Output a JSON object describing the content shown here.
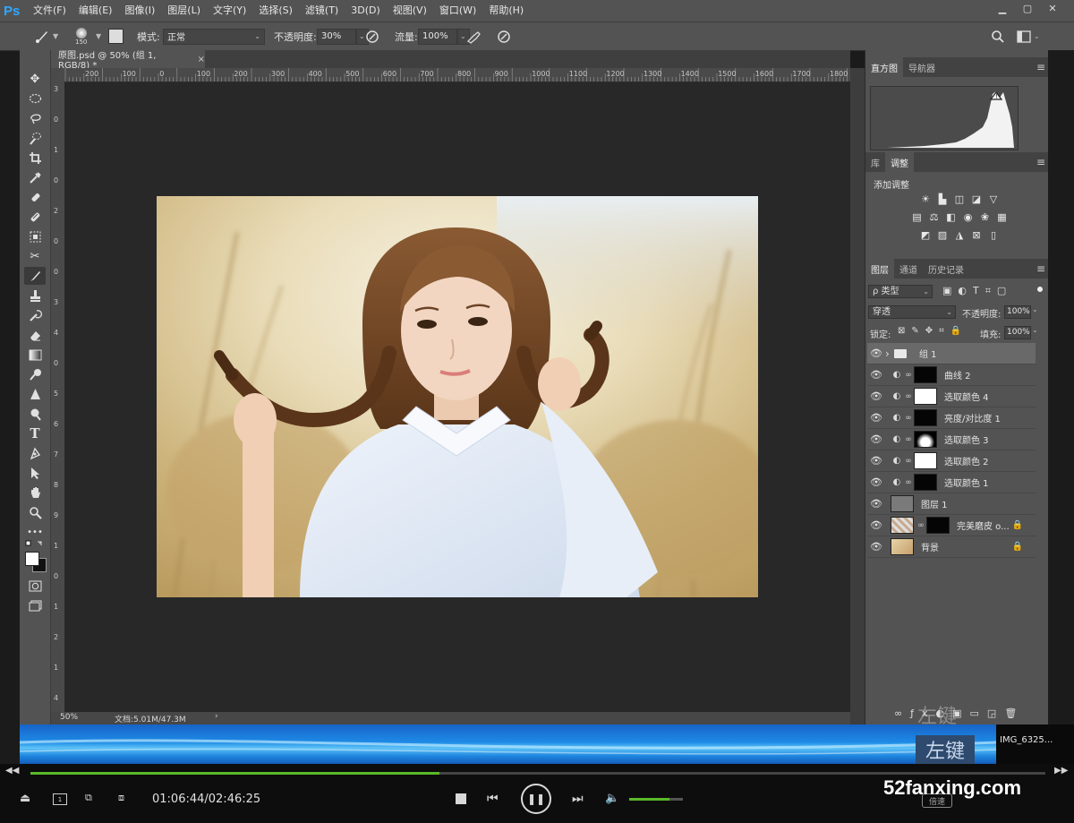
{
  "app": {
    "logo": "Ps"
  },
  "menu": [
    "文件(F)",
    "编辑(E)",
    "图像(I)",
    "图层(L)",
    "文字(Y)",
    "选择(S)",
    "滤镜(T)",
    "3D(D)",
    "视图(V)",
    "窗口(W)",
    "帮助(H)"
  ],
  "window_controls": [
    "minimize-icon",
    "restore-icon",
    "close-icon"
  ],
  "options": {
    "brush_size": "150",
    "mode_label": "模式:",
    "mode_value": "正常",
    "opacity_label": "不透明度:",
    "opacity_value": "30%",
    "flow_label": "流量:",
    "flow_value": "100%"
  },
  "document": {
    "tab_title": "原图.psd @ 50% (组 1, RGB/8) *",
    "close": "×",
    "zoom": "50%",
    "doc_info": "文档:5.01M/47.3M",
    "ruler_h": [
      "200",
      "100",
      "0",
      "100",
      "200",
      "300",
      "400",
      "500",
      "600",
      "700",
      "800",
      "900",
      "1000",
      "1100",
      "1200",
      "1300",
      "1400",
      "1500",
      "1600",
      "1700",
      "1800"
    ],
    "ruler_v": [
      "3",
      "0",
      "1",
      "0",
      "2",
      "0",
      "0",
      "3",
      "4",
      "0",
      "5",
      "6",
      "7",
      "8",
      "9",
      "1",
      "0",
      "1",
      "2",
      "1",
      "4"
    ]
  },
  "panels": {
    "histogram_tabs": [
      "直方图",
      "导航器"
    ],
    "adjust_tabs": [
      "库",
      "调整"
    ],
    "adjust_title": "添加调整",
    "layers_tabs": [
      "图层",
      "通道",
      "历史记录"
    ],
    "filter_label": "ρ 类型",
    "blend_mode": "穿透",
    "opacity_label": "不透明度:",
    "opacity_value": "100%",
    "lock_label": "锁定:",
    "fill_label": "填充:",
    "fill_value": "100%",
    "layers": [
      {
        "name": "组 1",
        "kind": "group",
        "selected": true
      },
      {
        "name": "曲线 2",
        "kind": "adjust",
        "mask": "dark"
      },
      {
        "name": "选取颜色 4",
        "kind": "adjust",
        "mask": "white"
      },
      {
        "name": "亮度/对比度 1",
        "kind": "adjust",
        "mask": "dark"
      },
      {
        "name": "选取颜色 3",
        "kind": "adjust",
        "mask": "figure"
      },
      {
        "name": "选取颜色 2",
        "kind": "adjust",
        "mask": "white"
      },
      {
        "name": "选取颜色 1",
        "kind": "adjust",
        "mask": "dark"
      },
      {
        "name": "图层 1",
        "kind": "gray"
      },
      {
        "name": "完美磨皮 o...",
        "kind": "smart",
        "locked": true
      },
      {
        "name": "背景",
        "kind": "photo",
        "locked": true
      }
    ],
    "watermark": "左键"
  },
  "desktop": {
    "file_label": "IMG_6325...",
    "left_key": "左键"
  },
  "player": {
    "time": "01:06:44/02:46:25",
    "progress": 0.403,
    "volume": 0.75,
    "speed": "倍速",
    "brand": "52fanxing.com"
  }
}
